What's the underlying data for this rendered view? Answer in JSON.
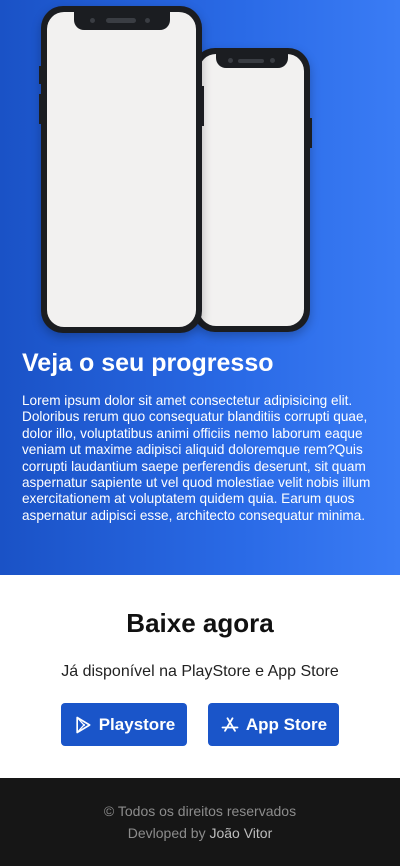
{
  "hero": {
    "title": "Veja o seu progresso",
    "text": "Lorem ipsum dolor sit amet consectetur adipisicing elit. Doloribus rerum quo consequatur blanditiis corrupti quae, dolor illo, voluptatibus animi officiis nemo laborum eaque veniam ut maxime adipisci aliquid doloremque rem?Quis corrupti laudantium saepe perferendis deserunt, sit quam aspernatur sapiente ut vel quod molestiae velit nobis illum exercitationem at voluptatem quidem quia. Earum quos aspernatur adipisci esse, architecto consequatur minima.",
    "image": "two-smartphones-mockup"
  },
  "download": {
    "title": "Baixe agora",
    "subtitle": "Já disponível na PlayStore e App Store",
    "buttons": [
      {
        "label": "Playstore",
        "icon": "play-store-icon"
      },
      {
        "label": "App Store",
        "icon": "app-store-icon"
      }
    ]
  },
  "footer": {
    "copyright": "© Todos os direitos reservados",
    "credit_prefix": "Devloped by ",
    "author": "João Vitor"
  },
  "colors": {
    "hero_gradient_start": "#1a52c6",
    "hero_gradient_end": "#3a7cf5",
    "button": "#1a55c9",
    "footer_bg": "#161616"
  }
}
